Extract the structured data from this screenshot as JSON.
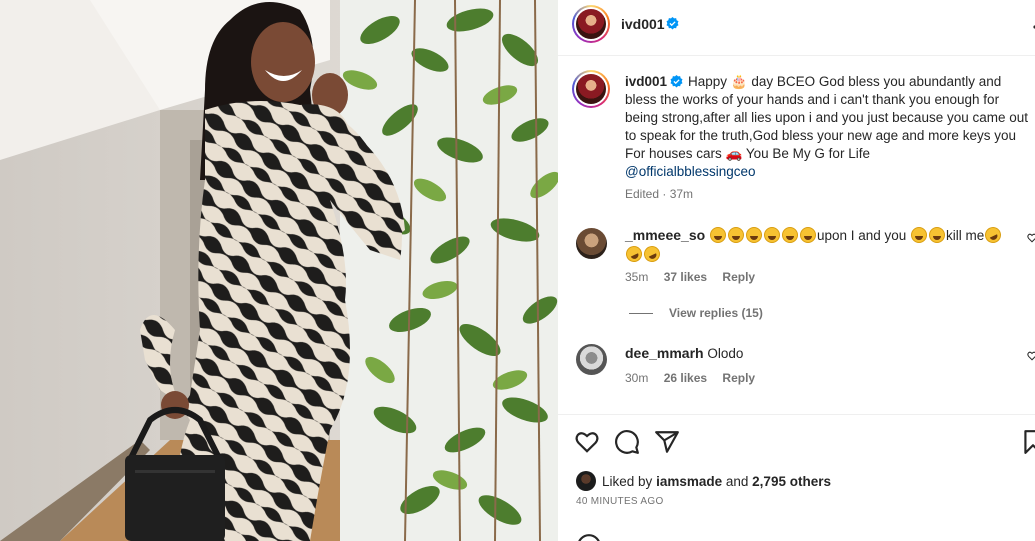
{
  "post": {
    "username": "ivd001",
    "verified": true
  },
  "caption": {
    "username": "ivd001",
    "text_before_cake": "Happy",
    "cake_emoji": "🎂",
    "text_main": "day BCEO God bless you abundantly and bless the works of your hands and i can't thank you enough for being strong,after all lies upon i and you just because you came out to speak for the truth,God bless your new age and more keys you For houses cars",
    "car_emoji": "🚗",
    "text_after_car": "You Be My G for Life",
    "mention": "@officialbblessingceo",
    "edited_label": "Edited",
    "time": "37m"
  },
  "comments": [
    {
      "username": "_mmeee_so",
      "text_after_emojis": "upon I and you",
      "text_tail": "kill me",
      "time": "35m",
      "likes": "37 likes",
      "reply_label": "Reply",
      "view_replies": "View replies (15)"
    },
    {
      "username": "dee_mmarh",
      "text": "Olodo",
      "time": "30m",
      "likes": "26 likes",
      "reply_label": "Reply"
    }
  ],
  "actions": {
    "liked_by_prefix": "Liked by",
    "liked_by_user": "iamsmade",
    "liked_by_and": "and",
    "liked_by_others": "2,795 others",
    "timestamp": "40 MINUTES AGO"
  },
  "colors": {
    "verified": "#0095f6",
    "mention": "#00376b",
    "secondary_text": "#737373",
    "divider": "#efefef"
  },
  "icons": [
    "verified-badge-icon",
    "more-options-icon",
    "heart-icon",
    "comment-icon",
    "share-icon",
    "bookmark-icon",
    "small-heart-icon",
    "emoji-icon"
  ]
}
